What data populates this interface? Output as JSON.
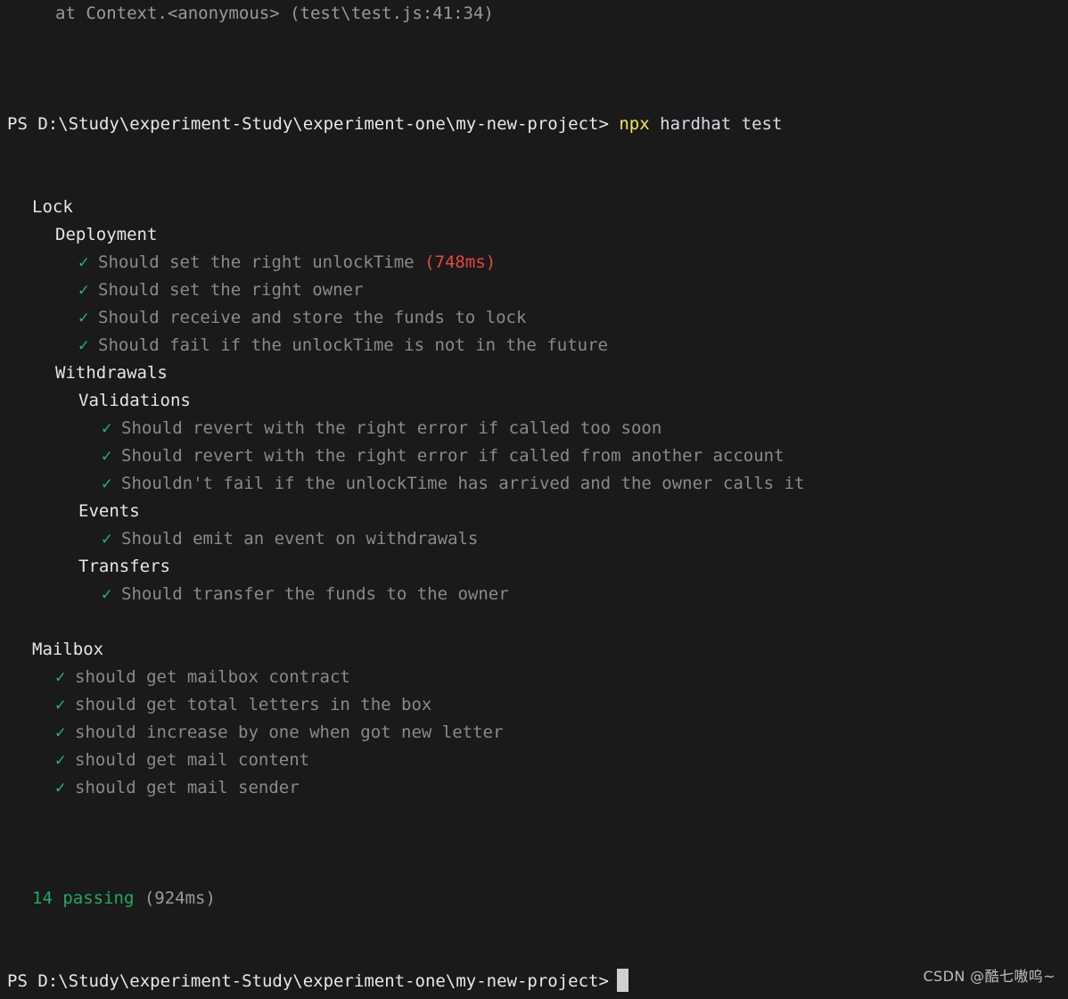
{
  "terminal": {
    "shell": "PowerShell",
    "background_color": "#1a1a1a",
    "cwd_prompt": "PS D:\\Study\\experiment-Study\\experiment-one\\my-new-project>",
    "colors": {
      "check": "#21ba72",
      "pass_summary": "#1faa62",
      "slow_duration": "#e8483f",
      "suite_title": "#e6e6e6",
      "test_text": "#8a8a8a",
      "dim_text": "#9a9a9a",
      "command_keyword": "#f2e85c",
      "prompt": "#e8e8e8"
    }
  },
  "scrollback": {
    "stack_trace_line": "at Context.<anonymous> (test\\test.js:41:34)"
  },
  "command": {
    "keyword": "npx",
    "args": "hardhat test"
  },
  "icons": {
    "check": "✓"
  },
  "suites": [
    {
      "title": "Lock",
      "groups": [
        {
          "title": "Deployment",
          "tests": [
            {
              "text": "Should set the right unlockTime",
              "duration": "(748ms)",
              "slow": true
            },
            {
              "text": "Should set the right owner",
              "duration": "",
              "slow": false
            },
            {
              "text": "Should receive and store the funds to lock",
              "duration": "",
              "slow": false
            },
            {
              "text": "Should fail if the unlockTime is not in the future",
              "duration": "",
              "slow": false
            }
          ]
        },
        {
          "title": "Withdrawals",
          "subgroups": [
            {
              "title": "Validations",
              "tests": [
                {
                  "text": "Should revert with the right error if called too soon",
                  "duration": "",
                  "slow": false
                },
                {
                  "text": "Should revert with the right error if called from another account",
                  "duration": "",
                  "slow": false
                },
                {
                  "text": "Shouldn't fail if the unlockTime has arrived and the owner calls it",
                  "duration": "",
                  "slow": false
                }
              ]
            },
            {
              "title": "Events",
              "tests": [
                {
                  "text": "Should emit an event on withdrawals",
                  "duration": "",
                  "slow": false
                }
              ]
            },
            {
              "title": "Transfers",
              "tests": [
                {
                  "text": "Should transfer the funds to the owner",
                  "duration": "",
                  "slow": false
                }
              ]
            }
          ]
        }
      ]
    },
    {
      "title": "Mailbox",
      "tests": [
        {
          "text": "should get mailbox contract",
          "duration": "",
          "slow": false
        },
        {
          "text": "should get total letters in the box",
          "duration": "",
          "slow": false
        },
        {
          "text": "should increase by one when got new letter",
          "duration": "",
          "slow": false
        },
        {
          "text": "should get mail content",
          "duration": "",
          "slow": false
        },
        {
          "text": "should get mail sender",
          "duration": "",
          "slow": false
        }
      ]
    }
  ],
  "summary": {
    "passing_count": "14 passing",
    "total_duration": "(924ms)"
  },
  "watermark": {
    "text": "CSDN @酷七嗷呜~"
  }
}
